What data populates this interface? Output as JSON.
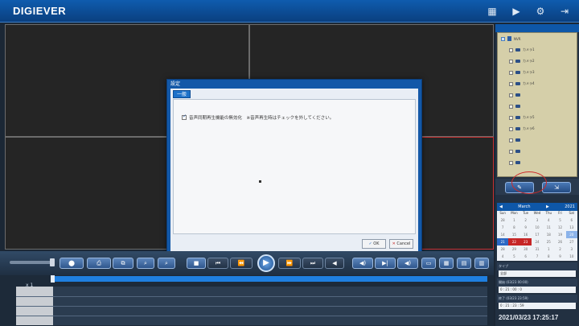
{
  "app": {
    "brand": "DIGIEVER"
  },
  "topbar": {
    "icons": [
      "grid-icon",
      "play-icon",
      "settings-icon",
      "logout-icon"
    ]
  },
  "dialog": {
    "title": "設定",
    "tab": "一般",
    "checkbox_label": "音声同期再生機能の無効化　※音声再生時はチェックを外してください。",
    "checkbox_checked": true,
    "ok_label": "OK",
    "cancel_label": "Cancel"
  },
  "tree": {
    "root": "NVR",
    "cameras": [
      "カメラ1",
      "カメラ2",
      "カメラ3",
      "カメラ4",
      "",
      "",
      "カメラ5",
      "カメラ6",
      "",
      "",
      ""
    ]
  },
  "calendar": {
    "month": "March",
    "year": "2021",
    "dow": [
      "Sun",
      "Mon",
      "Tue",
      "Wed",
      "Thu",
      "Fri",
      "Sat"
    ],
    "rows": [
      [
        "28",
        "1",
        "2",
        "3",
        "4",
        "5",
        "6"
      ],
      [
        "7",
        "8",
        "9",
        "10",
        "11",
        "12",
        "13"
      ],
      [
        "14",
        "15",
        "16",
        "17",
        "18",
        "19",
        "20"
      ],
      [
        "21",
        "22",
        "23",
        "24",
        "25",
        "26",
        "27"
      ],
      [
        "28",
        "29",
        "30",
        "31",
        "1",
        "2",
        "3"
      ],
      [
        "4",
        "5",
        "6",
        "7",
        "8",
        "9",
        "10"
      ]
    ]
  },
  "search": {
    "type_label": "タイプ",
    "type_value": "全部",
    "start_label": "開始 (03/23 00:00)",
    "start_value": "0 : 21 : 00 : 0",
    "end_label": "終了 (03/23 23:59)",
    "end_value": "0 : 21 : 23 : 59"
  },
  "status": {
    "datetime": "2021/03/23 17:25:17"
  },
  "playback": {
    "speed": "x 1"
  },
  "colors": {
    "accent": "#1f7fe0",
    "brand_bar": "#0f5cae",
    "selection": "#c62626"
  }
}
